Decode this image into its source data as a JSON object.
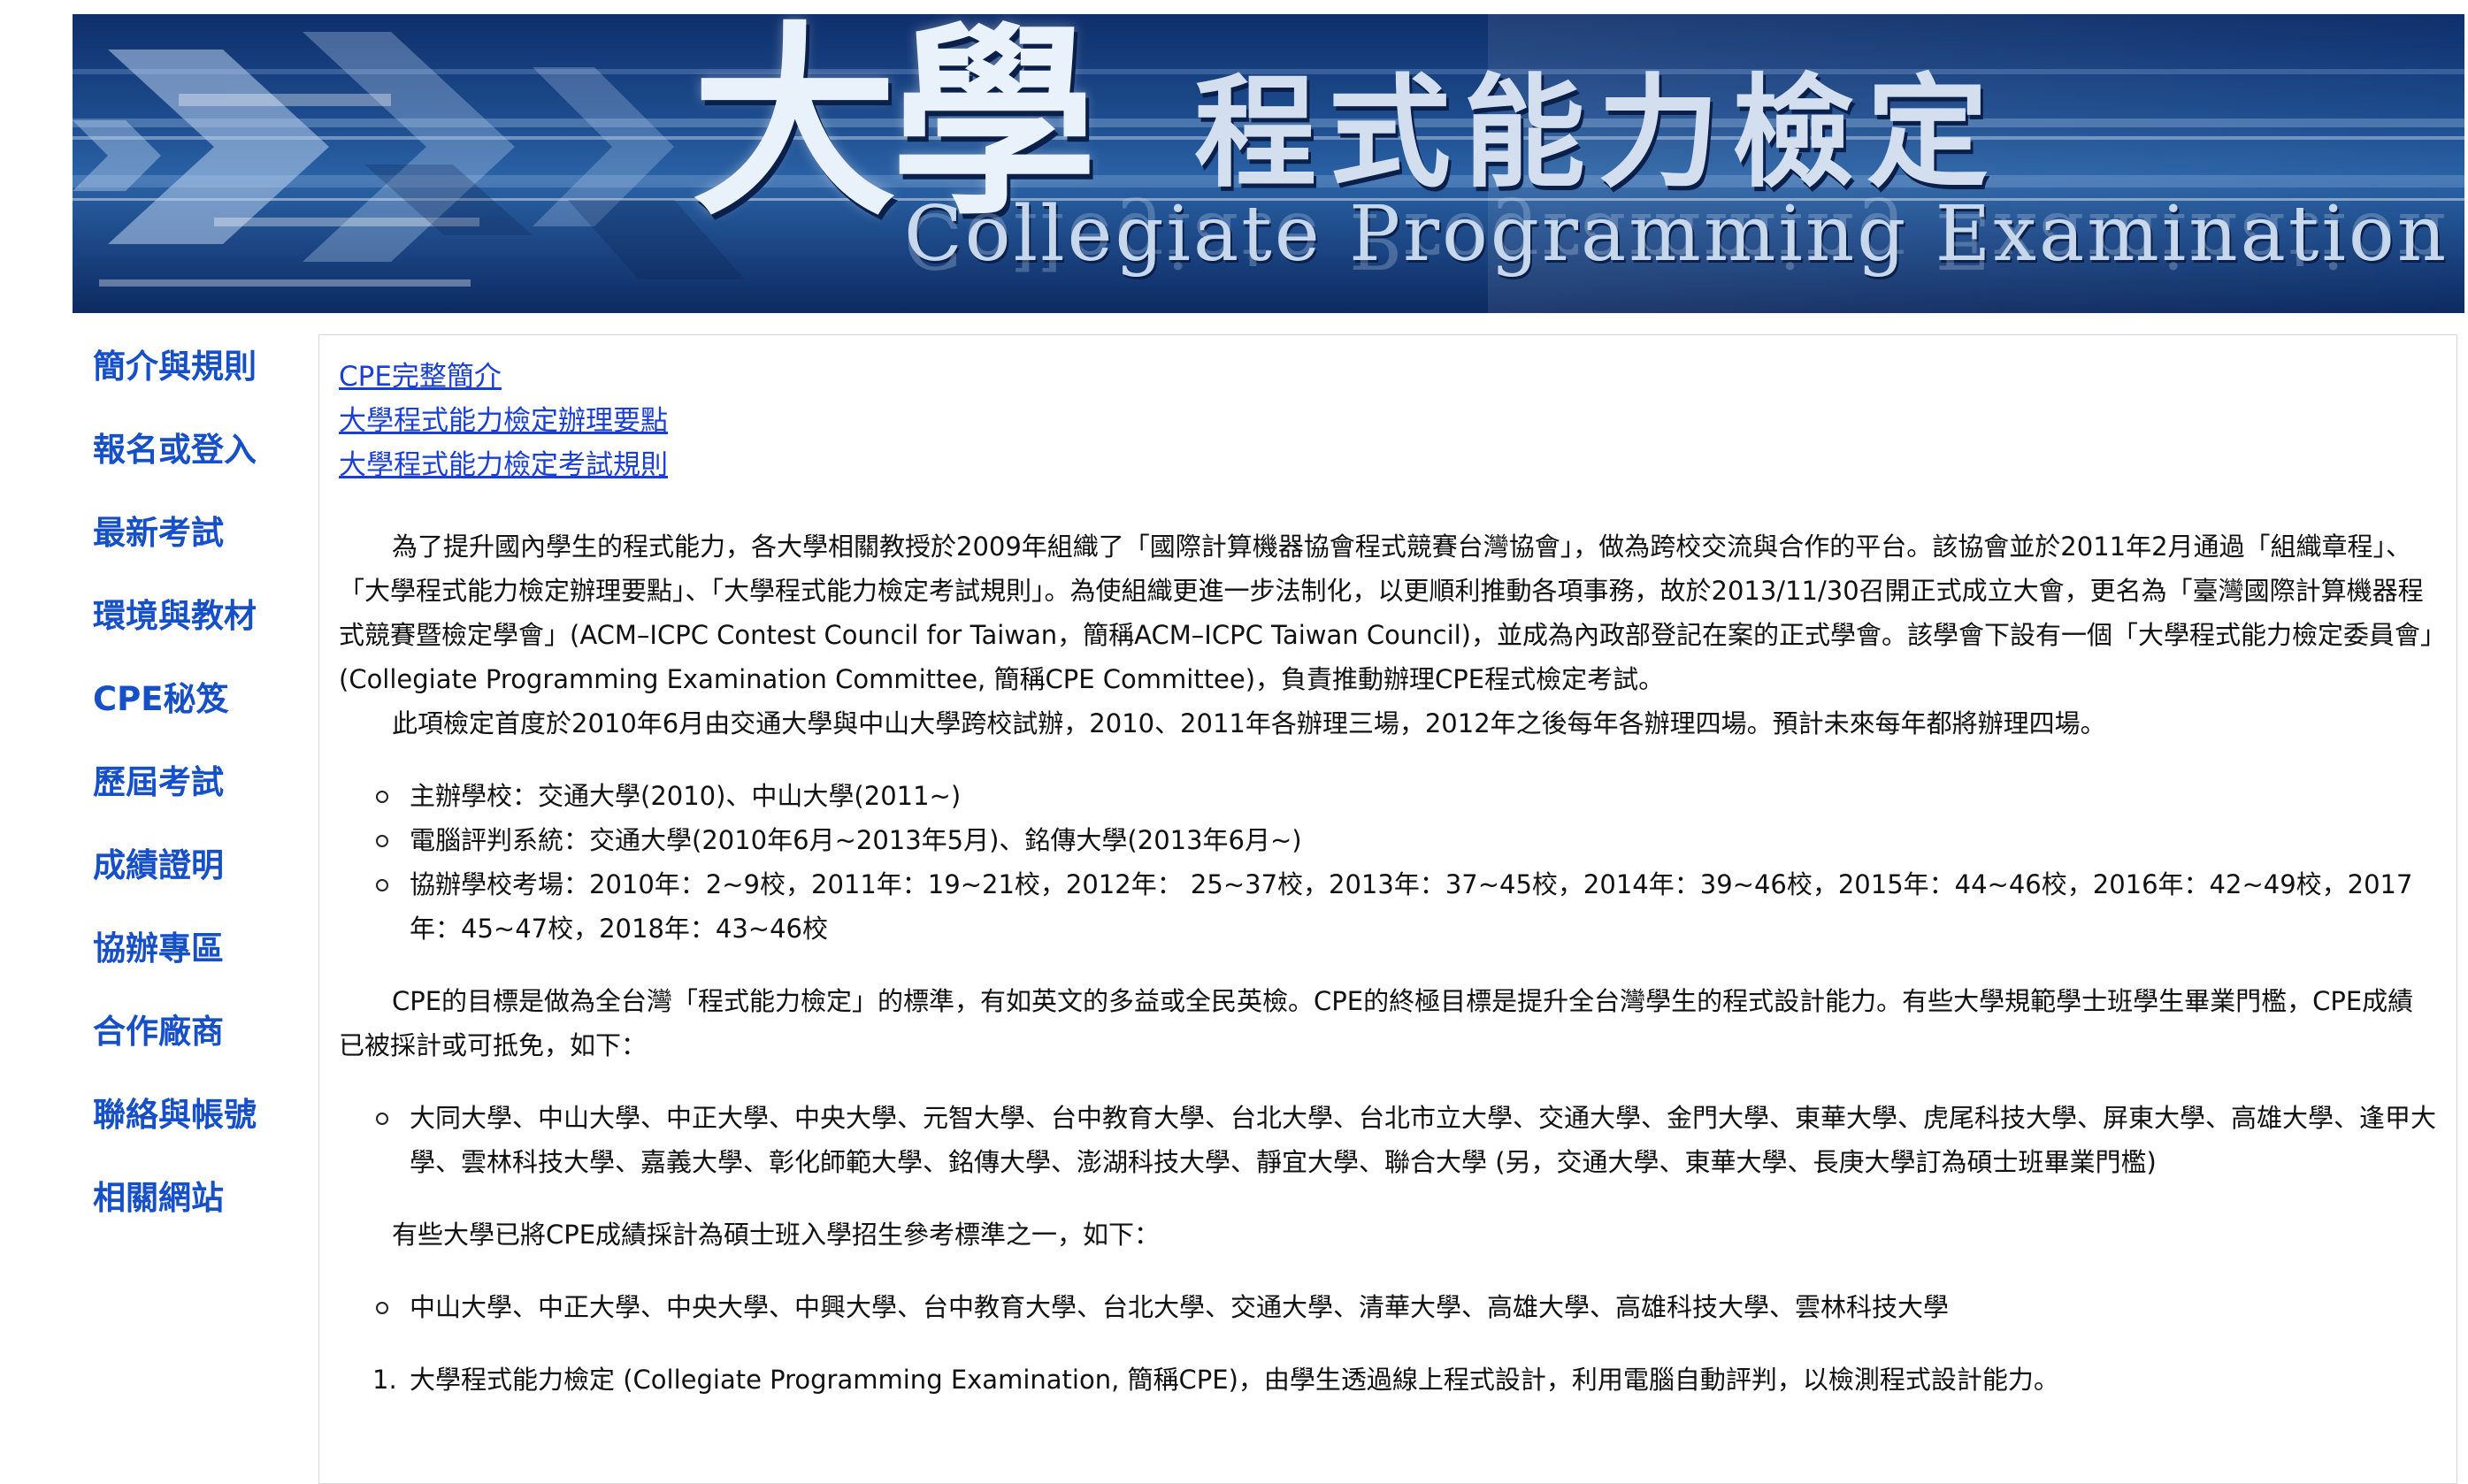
{
  "banner": {
    "title_main": "大學",
    "title_sub": "程式能力檢定",
    "title_en": "Collegiate Programming Examination"
  },
  "sidebar": {
    "items": [
      {
        "label": "簡介與規則",
        "icon": "none"
      },
      {
        "label": "報名或登入",
        "icon": "none"
      },
      {
        "label": "最新考試",
        "icon": "none"
      },
      {
        "label": "環境與教材",
        "icon": "none"
      },
      {
        "label": "CPE秘笈",
        "icon": "none"
      },
      {
        "label": "歷屆考試",
        "icon": "none"
      },
      {
        "label": "成績證明",
        "icon": "none"
      },
      {
        "label": "協辦專區",
        "icon": "none"
      },
      {
        "label": "合作廠商",
        "icon": "none"
      },
      {
        "label": "聯絡與帳號",
        "icon": "none"
      },
      {
        "label": "相關網站",
        "icon": "none"
      }
    ]
  },
  "content": {
    "links": [
      "CPE完整簡介",
      "大學程式能力檢定辦理要點",
      "大學程式能力檢定考試規則"
    ],
    "intro_para": "為了提升國內學生的程式能力，各大學相關教授於2009年組織了「國際計算機器協會程式競賽台灣協會」，做為跨校交流與合作的平台。該協會並於2011年2月通過「組織章程」、「大學程式能力檢定辦理要點」、「大學程式能力檢定考試規則」。為使組織更進一步法制化，以更順利推動各項事務，故於2013/11/30召開正式成立大會，更名為「臺灣國際計算機器程式競賽暨檢定學會」(ACM–ICPC Contest Council for Taiwan，簡稱ACM–ICPC Taiwan Council)，並成為內政部登記在案的正式學會。該學會下設有一個「大學程式能力檢定委員會」(Collegiate Programming Examination Committee, 簡稱CPE Committee)，負責推動辦理CPE程式檢定考試。",
    "history_para": "此項檢定首度於2010年6月由交通大學與中山大學跨校試辦，2010、2011年各辦理三場，2012年之後每年各辦理四場。預計未來每年都將辦理四場。",
    "history_items": [
      "主辦學校：交通大學(2010)、中山大學(2011~)",
      "電腦評判系統：交通大學(2010年6月~2013年5月)、銘傳大學(2013年6月~)",
      "協辦學校考場：2010年：2~9校，2011年：19~21校，2012年： 25~37校，2013年：37~45校，2014年：39~46校，2015年：44~46校，2016年：42~49校，2017年：45~47校，2018年：43~46校"
    ],
    "goal_para": "CPE的目標是做為全台灣「程式能力檢定」的標準，有如英文的多益或全民英檢。CPE的終極目標是提升全台灣學生的程式設計能力。有些大學規範學士班學生畢業門檻，CPE成績已被採計或可抵免，如下：",
    "bachelor_items": [
      "大同大學、中山大學、中正大學、中央大學、元智大學、台中教育大學、台北大學、台北市立大學、交通大學、金門大學、東華大學、虎尾科技大學、屏東大學、高雄大學、逢甲大學、雲林科技大學、嘉義大學、彰化師範大學、銘傳大學、澎湖科技大學、靜宜大學、聯合大學 (另，交通大學、東華大學、長庚大學訂為碩士班畢業門檻)"
    ],
    "master_para": "有些大學已將CPE成績採計為碩士班入學招生參考標準之一，如下：",
    "master_items": [
      "中山大學、中正大學、中央大學、中興大學、台中教育大學、台北大學、交通大學、清華大學、高雄大學、高雄科技大學、雲林科技大學"
    ],
    "numbered_items": [
      {
        "n": "1.",
        "text": "大學程式能力檢定 (Collegiate Programming Examination, 簡稱CPE)，由學生透過線上程式設計，利用電腦自動評判，以檢測程式設計能力。"
      }
    ]
  }
}
